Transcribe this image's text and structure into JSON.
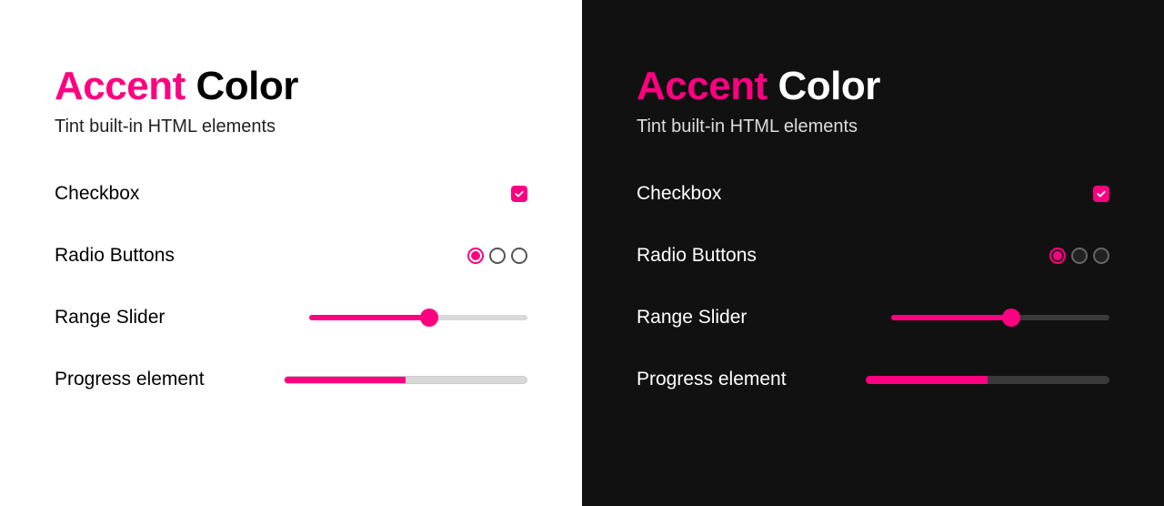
{
  "accent_color": "#ff0080",
  "title": {
    "accent_word": "Accent",
    "rest_word": "Color"
  },
  "subtitle": "Tint built-in HTML elements",
  "rows": {
    "checkbox": {
      "label": "Checkbox",
      "checked": true
    },
    "radio": {
      "label": "Radio Buttons",
      "options": [
        true,
        false,
        false
      ]
    },
    "range": {
      "label": "Range Slider",
      "value": 55,
      "min": 0,
      "max": 100
    },
    "progress": {
      "label": "Progress element",
      "value": 50,
      "max": 100
    }
  },
  "panels": [
    "light",
    "dark"
  ]
}
